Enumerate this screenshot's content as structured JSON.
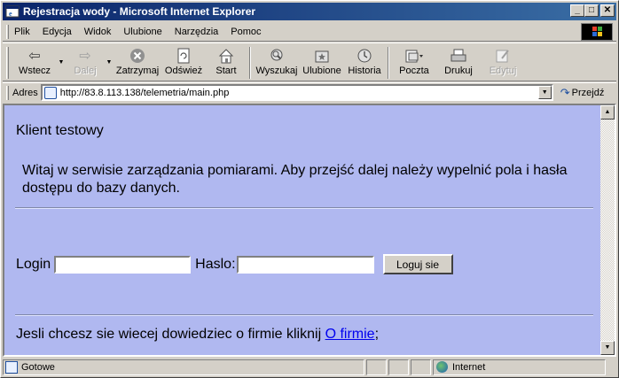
{
  "window": {
    "title": "Rejestracja wody - Microsoft Internet Explorer",
    "buttons": {
      "minimize": "_",
      "maximize": "□",
      "close": "✕"
    }
  },
  "menu": {
    "items": [
      "Plik",
      "Edycja",
      "Widok",
      "Ulubione",
      "Narzędzia",
      "Pomoc"
    ]
  },
  "toolbar": {
    "back": "Wstecz",
    "forward": "Dalej",
    "stop": "Zatrzymaj",
    "refresh": "Odśwież",
    "home": "Start",
    "search": "Wyszukaj",
    "favorites": "Ulubione",
    "history": "Historia",
    "mail": "Poczta",
    "print": "Drukuj",
    "edit": "Edytuj"
  },
  "address": {
    "label": "Adres",
    "url": "http://83.8.113.138/telemetria/main.php",
    "go_label": "Przejdź"
  },
  "page": {
    "heading": "Klient testowy",
    "welcome": "Witaj w serwisie zarządzania pomiarami. Aby przejść dalej należy wypelnić pola i hasła dostępu do bazy danych.",
    "login_label": "Login",
    "login_value": "",
    "password_label": "Haslo:",
    "password_value": "",
    "login_button": "Loguj sie",
    "footer_text": "Jesli chcesz sie wiecej dowiedziec o firmie kliknij ",
    "footer_link": "O firmie",
    "footer_end": ";",
    "background_color": "#b0b8f0"
  },
  "statusbar": {
    "status": "Gotowe",
    "zone": "Internet"
  }
}
